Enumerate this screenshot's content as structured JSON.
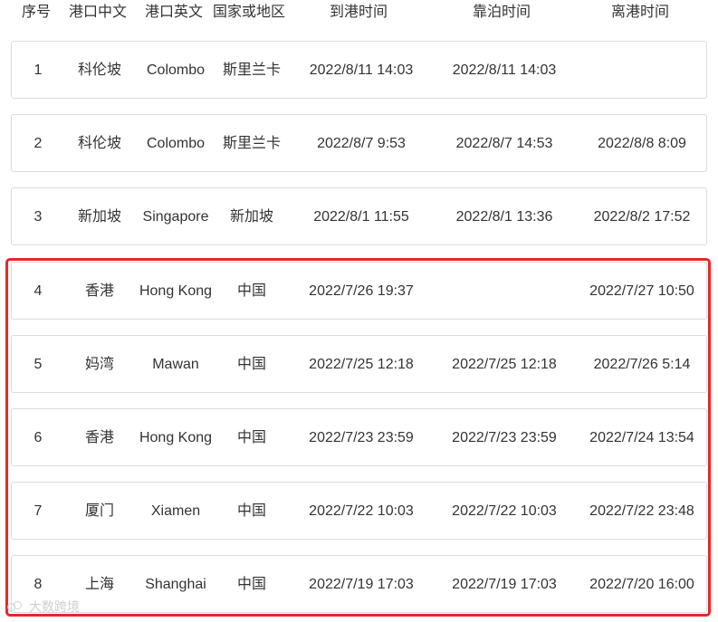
{
  "table": {
    "headers": [
      "序号",
      "港口中文",
      "港口英文",
      "国家或地区",
      "到港时间",
      "靠泊时间",
      "离港时间"
    ],
    "rows": [
      {
        "no": "1",
        "port_cn": "科伦坡",
        "port_en": "Colombo",
        "country": "斯里兰卡",
        "arrival": "2022/8/11 14:03",
        "berthing": "2022/8/11 14:03",
        "departure": ""
      },
      {
        "no": "2",
        "port_cn": "科伦坡",
        "port_en": "Colombo",
        "country": "斯里兰卡",
        "arrival": "2022/8/7 9:53",
        "berthing": "2022/8/7 14:53",
        "departure": "2022/8/8 8:09"
      },
      {
        "no": "3",
        "port_cn": "新加坡",
        "port_en": "Singapore",
        "country": "新加坡",
        "arrival": "2022/8/1 11:55",
        "berthing": "2022/8/1 13:36",
        "departure": "2022/8/2 17:52"
      },
      {
        "no": "4",
        "port_cn": "香港",
        "port_en": "Hong Kong",
        "country": "中国",
        "arrival": "2022/7/26 19:37",
        "berthing": "",
        "departure": "2022/7/27 10:50"
      },
      {
        "no": "5",
        "port_cn": "妈湾",
        "port_en": "Mawan",
        "country": "中国",
        "arrival": "2022/7/25 12:18",
        "berthing": "2022/7/25 12:18",
        "departure": "2022/7/26 5:14"
      },
      {
        "no": "6",
        "port_cn": "香港",
        "port_en": "Hong Kong",
        "country": "中国",
        "arrival": "2022/7/23 23:59",
        "berthing": "2022/7/23 23:59",
        "departure": "2022/7/24 13:54"
      },
      {
        "no": "7",
        "port_cn": "厦门",
        "port_en": "Xiamen",
        "country": "中国",
        "arrival": "2022/7/22 10:03",
        "berthing": "2022/7/22 10:03",
        "departure": "2022/7/22 23:48"
      },
      {
        "no": "8",
        "port_cn": "上海",
        "port_en": "Shanghai",
        "country": "中国",
        "arrival": "2022/7/19 17:03",
        "berthing": "2022/7/19 17:03",
        "departure": "2022/7/20 16:00"
      }
    ]
  },
  "highlight": {
    "color": "#e8262b",
    "rows": [
      "4",
      "5",
      "6",
      "7",
      "8"
    ]
  },
  "watermark": {
    "text": "大数跨境"
  }
}
